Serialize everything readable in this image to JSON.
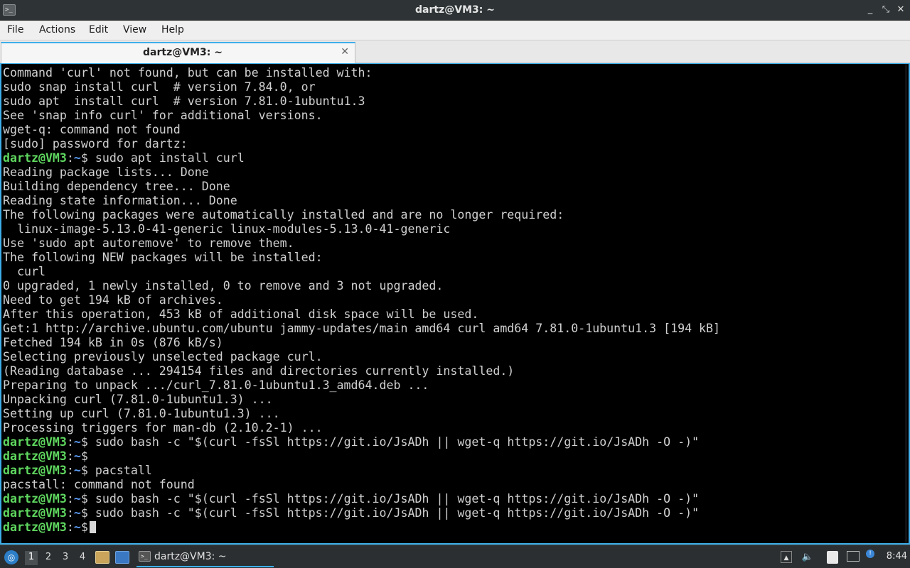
{
  "window": {
    "title": "dartz@VM3: ~",
    "buttons": [
      "_",
      "⤡",
      "✕"
    ]
  },
  "menu": [
    "File",
    "Actions",
    "Edit",
    "View",
    "Help"
  ],
  "tab": {
    "label": "dartz@VM3: ~",
    "close": "✕"
  },
  "prompt": {
    "user": "dartz@VM3",
    "colon": ":",
    "path": "~",
    "dollar": "$"
  },
  "terminal_lines": [
    {
      "type": "out",
      "text": "Command 'curl' not found, but can be installed with:"
    },
    {
      "type": "out",
      "text": "sudo snap install curl  # version 7.84.0, or"
    },
    {
      "type": "out",
      "text": "sudo apt  install curl  # version 7.81.0-1ubuntu1.3"
    },
    {
      "type": "out",
      "text": "See 'snap info curl' for additional versions."
    },
    {
      "type": "out",
      "text": "wget-q: command not found"
    },
    {
      "type": "out",
      "text": "[sudo] password for dartz:"
    },
    {
      "type": "cmd",
      "text": " sudo apt install curl"
    },
    {
      "type": "out",
      "text": "Reading package lists... Done"
    },
    {
      "type": "out",
      "text": "Building dependency tree... Done"
    },
    {
      "type": "out",
      "text": "Reading state information... Done"
    },
    {
      "type": "out",
      "text": "The following packages were automatically installed and are no longer required:"
    },
    {
      "type": "out",
      "text": "  linux-image-5.13.0-41-generic linux-modules-5.13.0-41-generic"
    },
    {
      "type": "out",
      "text": "Use 'sudo apt autoremove' to remove them."
    },
    {
      "type": "out",
      "text": "The following NEW packages will be installed:"
    },
    {
      "type": "out",
      "text": "  curl"
    },
    {
      "type": "out",
      "text": "0 upgraded, 1 newly installed, 0 to remove and 3 not upgraded."
    },
    {
      "type": "out",
      "text": "Need to get 194 kB of archives."
    },
    {
      "type": "out",
      "text": "After this operation, 453 kB of additional disk space will be used."
    },
    {
      "type": "out",
      "text": "Get:1 http://archive.ubuntu.com/ubuntu jammy-updates/main amd64 curl amd64 7.81.0-1ubuntu1.3 [194 kB]"
    },
    {
      "type": "out",
      "text": "Fetched 194 kB in 0s (876 kB/s)"
    },
    {
      "type": "out",
      "text": "Selecting previously unselected package curl."
    },
    {
      "type": "out",
      "text": "(Reading database ... 294154 files and directories currently installed.)"
    },
    {
      "type": "out",
      "text": "Preparing to unpack .../curl_7.81.0-1ubuntu1.3_amd64.deb ..."
    },
    {
      "type": "out",
      "text": "Unpacking curl (7.81.0-1ubuntu1.3) ..."
    },
    {
      "type": "out",
      "text": "Setting up curl (7.81.0-1ubuntu1.3) ..."
    },
    {
      "type": "out",
      "text": "Processing triggers for man-db (2.10.2-1) ..."
    },
    {
      "type": "cmd",
      "text": " sudo bash -c \"$(curl -fsSl https://git.io/JsADh || wget-q https://git.io/JsADh -O -)\""
    },
    {
      "type": "cmd",
      "text": ""
    },
    {
      "type": "cmd",
      "text": " pacstall"
    },
    {
      "type": "out",
      "text": "pacstall: command not found"
    },
    {
      "type": "cmd",
      "text": " sudo bash -c \"$(curl -fsSl https://git.io/JsADh || wget-q https://git.io/JsADh -O -)\""
    },
    {
      "type": "cmd",
      "text": " sudo bash -c \"$(curl -fsSl https://git.io/JsADh || wget-q https://git.io/JsADh -O -)\""
    },
    {
      "type": "cursor",
      "text": " "
    }
  ],
  "taskbar": {
    "workspaces": [
      "1",
      "2",
      "3",
      "4"
    ],
    "active_workspace": "1",
    "task_label": "dartz@VM3: ~",
    "clock": "8:44"
  },
  "colors": {
    "accent": "#3daee9",
    "prompt_user": "#5fd75f",
    "prompt_path": "#5c9cf5",
    "terminal_bg": "#000000",
    "terminal_fg": "#d0d0d0"
  }
}
